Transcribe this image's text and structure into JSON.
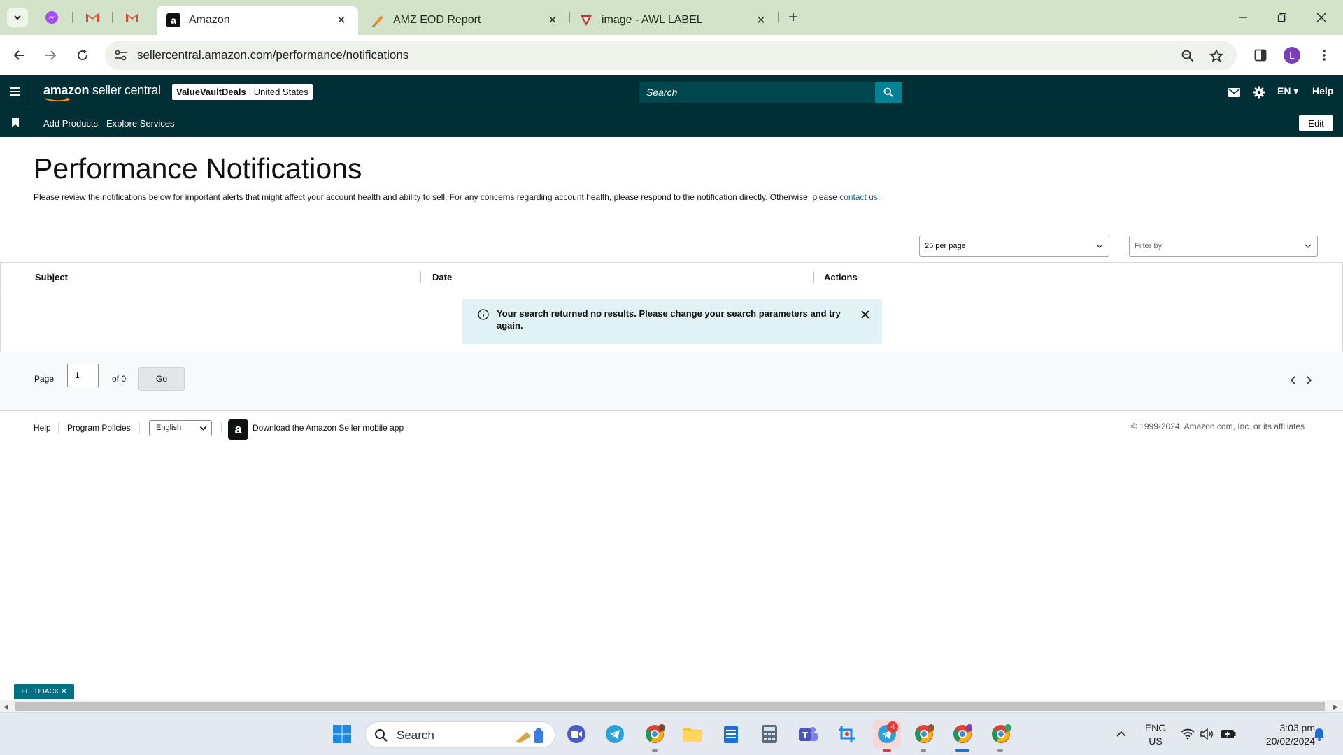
{
  "browser": {
    "tabs": [
      {
        "title": "Amazon",
        "active": true
      },
      {
        "title": "AMZ EOD Report",
        "active": false
      },
      {
        "title": "image - AWL LABEL",
        "active": false
      }
    ],
    "url": "sellercentral.amazon.com/performance/notifications",
    "profile_initial": "L"
  },
  "header": {
    "logo_bold": "amazon",
    "logo_rest": " seller central",
    "account_name": "ValueVaultDeals",
    "account_region": "| United States",
    "search_placeholder": "Search",
    "language": "EN ▾",
    "help": "Help"
  },
  "bookmarks": {
    "items": [
      "Add Products",
      "Explore Services"
    ],
    "edit_label": "Edit"
  },
  "page": {
    "title": "Performance Notifications",
    "intro_text": "Please review the notifications below for important alerts that might affect your account health and ability to sell. For any concerns regarding account health, please respond to the notification directly. Otherwise, please ",
    "intro_link": "contact us",
    "intro_end": "."
  },
  "controls": {
    "per_page": "25 per page",
    "filter_placeholder": "Filter by"
  },
  "table": {
    "columns": [
      "Subject",
      "Date",
      "Actions"
    ],
    "empty_message": "Your search returned no results. Please change your search parameters and try again."
  },
  "pagination": {
    "page_label": "Page",
    "current_page": "1",
    "of_label": "of 0",
    "go_label": "Go"
  },
  "footer": {
    "help": "Help",
    "policies": "Program Policies",
    "language": "English",
    "app_text": "Download the Amazon Seller mobile app",
    "copyright": "© 1999-2024, Amazon.com, Inc. or its affiliates"
  },
  "feedback": "FEEDBACK ✕",
  "taskbar": {
    "search": "Search",
    "telegram_badge": "4",
    "lang_line1": "ENG",
    "lang_line2": "US",
    "time": "3:03 pm",
    "date": "20/02/2024"
  },
  "colors": {
    "header_bg": "#002f36",
    "search_button": "#008296",
    "link": "#007185",
    "alert_bg": "#e0f2f5",
    "tabstrip": "#d3e3c9"
  }
}
